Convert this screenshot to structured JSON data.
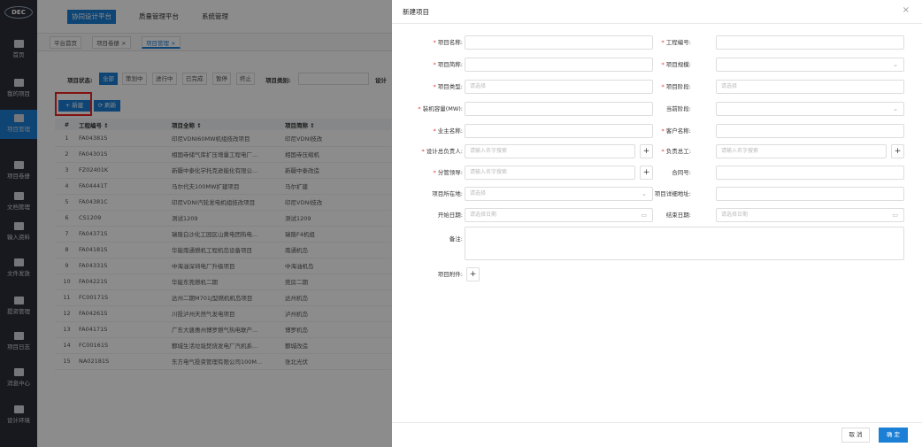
{
  "logo": "DEC",
  "sidebar": [
    {
      "label": "首页",
      "icon": "home-icon"
    },
    {
      "label": "我的项目",
      "icon": "stack-icon"
    },
    {
      "label": "项目管理",
      "icon": "stack-icon"
    },
    {
      "label": "项目卷册",
      "icon": "folder-icon"
    },
    {
      "label": "文档管理",
      "icon": "folder-icon"
    },
    {
      "label": "输入资料",
      "icon": "file-icon"
    },
    {
      "label": "文件发放",
      "icon": "file-icon"
    },
    {
      "label": "提资管理",
      "icon": "doc-icon"
    },
    {
      "label": "项目日志",
      "icon": "list-icon"
    },
    {
      "label": "消息中心",
      "icon": "chat-icon"
    },
    {
      "label": "设计环境",
      "icon": "tools-icon"
    }
  ],
  "topnav": [
    "协同设计平台",
    "质量管理平台",
    "系统管理"
  ],
  "tabs": [
    "平台首页",
    "项目卷册 ×",
    "项目管理 ×"
  ],
  "filter": {
    "status_label": "项目状态:",
    "statuses": [
      "全部",
      "策划中",
      "进行中",
      "已完成",
      "暂停",
      "终止"
    ],
    "type_label": "项目类别:",
    "design_label": "设计"
  },
  "actions": {
    "new": "+ 新建",
    "refresh": "⟳ 刷新"
  },
  "table": {
    "headers": [
      "#",
      "工程编号 ↕",
      "项目全称 ↕",
      "项目简称 ↕"
    ],
    "rows": [
      [
        "1",
        "FA04381S",
        "印尼VDNI60MW机组技改项目",
        "印尼VDNI技改"
      ],
      [
        "2",
        "FA04301S",
        "相国寺储气库扩压增量工程电厂...",
        "相国寺压缩机"
      ],
      [
        "3",
        "FZ02401K",
        "新疆中泰化学托克逊能化有限公...",
        "新疆中泰改造"
      ],
      [
        "4",
        "FA04441T",
        "马尔代夫100MW扩建项目",
        "马尔扩建"
      ],
      [
        "5",
        "FA04381C",
        "印尼VDNI汽轮发电机组技改项目",
        "印尼VDNI技改"
      ],
      [
        "6",
        "CS1209",
        "测试1209",
        "测试1209"
      ],
      [
        "7",
        "FA04371S",
        "瑞陵白沙化工园区山黄电团热电...",
        "瑞陵F4机组"
      ],
      [
        "8",
        "FA04181S",
        "华能南通燃机工程机岛设备项目",
        "南通机岛"
      ],
      [
        "9",
        "FA04331S",
        "中海油深圳电厂升级项目",
        "中海油机岛"
      ],
      [
        "10",
        "FA04221S",
        "华能东莞燃机二期",
        "莞房二期"
      ],
      [
        "11",
        "FC00171S",
        "达州二期M701J型燃机机岛项目",
        "达州机岛"
      ],
      [
        "12",
        "FA04261S",
        "川投泸州天然气发电项目",
        "泸州机岛"
      ],
      [
        "13",
        "FA04171S",
        "广东大唐惠州博罗燃气热电联产...",
        "博罗机岛"
      ],
      [
        "14",
        "FC00161S",
        "鄞城生活垃圾焚烧发电厂汽机系...",
        "鄞城改造"
      ],
      [
        "15",
        "NA02181S",
        "东方电气投资管理有限公司100M...",
        "张北光伏"
      ]
    ]
  },
  "modal": {
    "title": "新建项目",
    "close": "×",
    "fields_left": [
      {
        "label": "项目名称:",
        "req": true,
        "value": ""
      },
      {
        "label": "项目简称:",
        "req": true,
        "value": ""
      },
      {
        "label": "项目类型:",
        "req": true,
        "value": "请选择"
      },
      {
        "label": "装机容量(MW):",
        "req": true,
        "value": ""
      },
      {
        "label": "业主名称:",
        "req": true,
        "value": ""
      },
      {
        "label": "设计总负责人:",
        "req": true,
        "value": "请输入名字搜索",
        "plus": true
      },
      {
        "label": "分管领导:",
        "req": true,
        "value": "请输入名字搜索",
        "plus": true
      },
      {
        "label": "项目所在地:",
        "req": false,
        "value": "请选择",
        "chev": true
      },
      {
        "label": "开始日期:",
        "req": false,
        "value": "请选择日期",
        "cal": true
      }
    ],
    "fields_right": [
      {
        "label": "工程编号:",
        "req": true,
        "value": ""
      },
      {
        "label": "项目规模:",
        "req": true,
        "value": "",
        "chev": true
      },
      {
        "label": "项目阶段:",
        "req": true,
        "value": "请选择"
      },
      {
        "label": "当前阶段:",
        "req": false,
        "value": "",
        "chev": true
      },
      {
        "label": "客户名称:",
        "req": true,
        "value": ""
      },
      {
        "label": "负责总工:",
        "req": true,
        "value": "请输入名字搜索",
        "plus": true
      },
      {
        "label": "合同号:",
        "req": false,
        "value": ""
      },
      {
        "label": "项目详细地址:",
        "req": false,
        "value": ""
      },
      {
        "label": "结束日期:",
        "req": false,
        "value": "请选择日期",
        "cal": true
      }
    ],
    "remark_label": "备注:",
    "attach_label": "项目附件:",
    "attach_plus": "+",
    "cancel": "取 消",
    "ok": "确 定"
  }
}
